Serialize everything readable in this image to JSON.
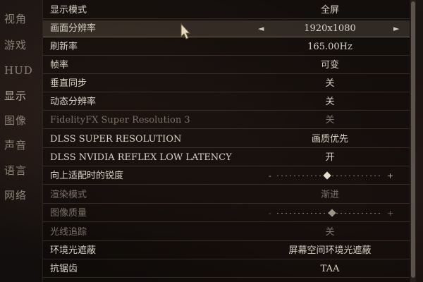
{
  "sidebar": {
    "categories": [
      "视角",
      "游戏",
      "HUD",
      "显示",
      "图像",
      "声音",
      "语言",
      "网络"
    ],
    "active_index": 3
  },
  "settings": [
    {
      "label": "显示模式",
      "type": "value",
      "value": "全屏"
    },
    {
      "label": "画面分辨率",
      "type": "arrows",
      "value": "1920x1080",
      "highlight": true,
      "left_arrow": "◄",
      "right_arrow": "►"
    },
    {
      "label": "刷新率",
      "type": "value",
      "value": "165.00Hz"
    },
    {
      "label": "帧率",
      "type": "value",
      "value": "可变"
    },
    {
      "label": "垂直同步",
      "type": "value",
      "value": "关"
    },
    {
      "label": "动态分辨率",
      "type": "value",
      "value": "关"
    },
    {
      "label": "FidelityFX Super Resolution 3",
      "type": "value",
      "value": "关",
      "disabled": true
    },
    {
      "label": "DLSS SUPER RESOLUTION",
      "type": "value",
      "value": "画质优先"
    },
    {
      "label": "DLSS NVIDIA REFLEX LOW LATENCY",
      "type": "value",
      "value": "开"
    },
    {
      "label": "向上适配时的锐度",
      "type": "slider",
      "level": 0.47,
      "minus": "-",
      "plus": "+"
    },
    {
      "label": "渲染模式",
      "type": "value",
      "value": "渐进",
      "disabled": true
    },
    {
      "label": "图像质量",
      "type": "slider",
      "level": 0.52,
      "minus": "-",
      "plus": "+",
      "disabled": true
    },
    {
      "label": "光线追踪",
      "type": "value",
      "value": "关",
      "disabled": true
    },
    {
      "label": "环境光遮蔽",
      "type": "value",
      "value": "屏幕空间环境光遮蔽"
    },
    {
      "label": "抗锯齿",
      "type": "value",
      "value": "TAA"
    }
  ],
  "colors": {
    "text": "#d9d2c6",
    "disabled_text": "#7a7167",
    "highlight_row": "#3a332d"
  }
}
